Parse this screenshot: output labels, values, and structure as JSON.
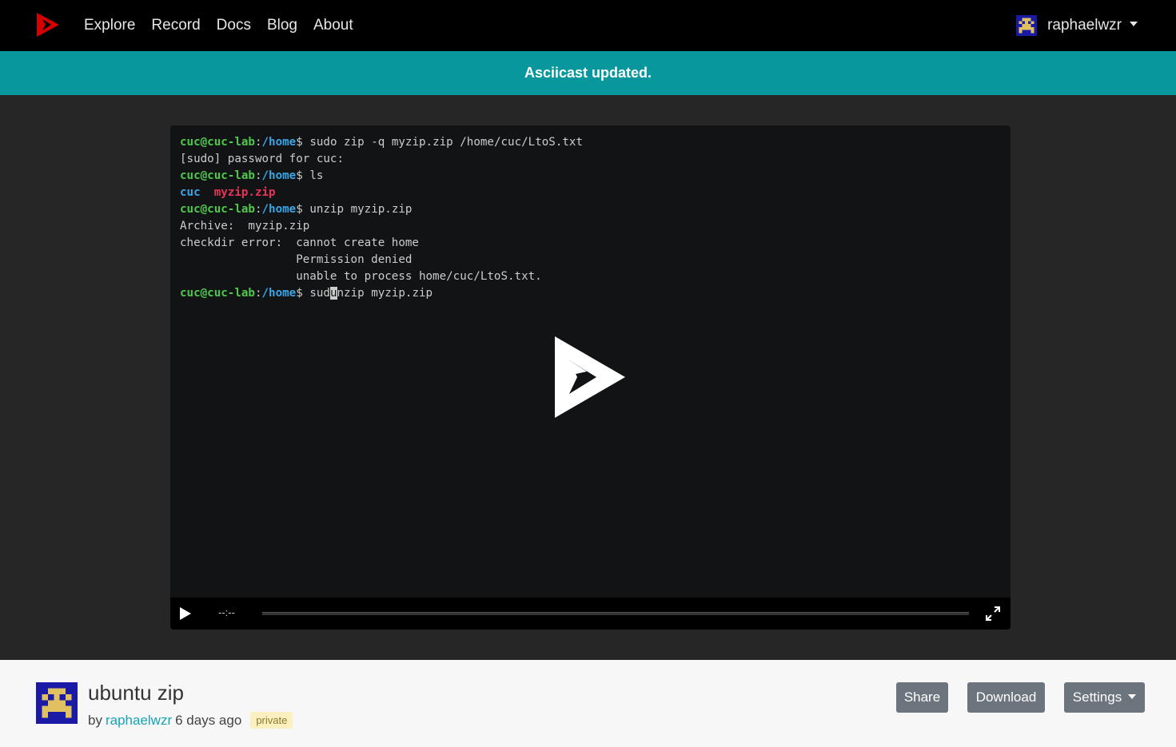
{
  "nav": {
    "links": [
      "Explore",
      "Record",
      "Docs",
      "Blog",
      "About"
    ],
    "username": "raphaelwzr"
  },
  "flash": {
    "message": "Asciicast updated."
  },
  "terminal": {
    "lines": [
      [
        {
          "t": "cuc@cuc-lab",
          "c": "p-user"
        },
        {
          "t": ":",
          "c": ""
        },
        {
          "t": "/home",
          "c": "p-path"
        },
        {
          "t": "$ sudo zip -q myzip.zip /home/cuc/LtoS.txt",
          "c": ""
        }
      ],
      [
        {
          "t": "[sudo] password for cuc:",
          "c": ""
        }
      ],
      [
        {
          "t": "cuc@cuc-lab",
          "c": "p-user"
        },
        {
          "t": ":",
          "c": ""
        },
        {
          "t": "/home",
          "c": "p-path"
        },
        {
          "t": "$ ls",
          "c": ""
        }
      ],
      [
        {
          "t": "cuc",
          "c": "f-dir"
        },
        {
          "t": "  ",
          "c": ""
        },
        {
          "t": "myzip.zip",
          "c": "f-zip"
        }
      ],
      [
        {
          "t": "cuc@cuc-lab",
          "c": "p-user"
        },
        {
          "t": ":",
          "c": ""
        },
        {
          "t": "/home",
          "c": "p-path"
        },
        {
          "t": "$ unzip myzip.zip",
          "c": ""
        }
      ],
      [
        {
          "t": "Archive:  myzip.zip",
          "c": ""
        }
      ],
      [
        {
          "t": "checkdir error:  cannot create home",
          "c": ""
        }
      ],
      [
        {
          "t": "                 Permission denied",
          "c": ""
        }
      ],
      [
        {
          "t": "                 unable to process home/cuc/LtoS.txt.",
          "c": ""
        }
      ],
      [
        {
          "t": "cuc@cuc-lab",
          "c": "p-user"
        },
        {
          "t": ":",
          "c": ""
        },
        {
          "t": "/home",
          "c": "p-path"
        },
        {
          "t": "$ sud",
          "c": ""
        },
        {
          "t": "u",
          "c": "cursor"
        },
        {
          "t": "nzip myzip.zip",
          "c": ""
        }
      ]
    ]
  },
  "player": {
    "time": "--:--",
    "progress": 0
  },
  "asciicast": {
    "title": "ubuntu zip",
    "by_label": "by",
    "author": "raphaelwzr",
    "time_ago": "6 days ago",
    "visibility": "private"
  },
  "actions": {
    "share": "Share",
    "download": "Download",
    "settings": "Settings"
  },
  "colors": {
    "flash_bg": "#08979c",
    "logo": "#d40000",
    "button_bg": "#6c757d",
    "link": "#17a2b8"
  }
}
